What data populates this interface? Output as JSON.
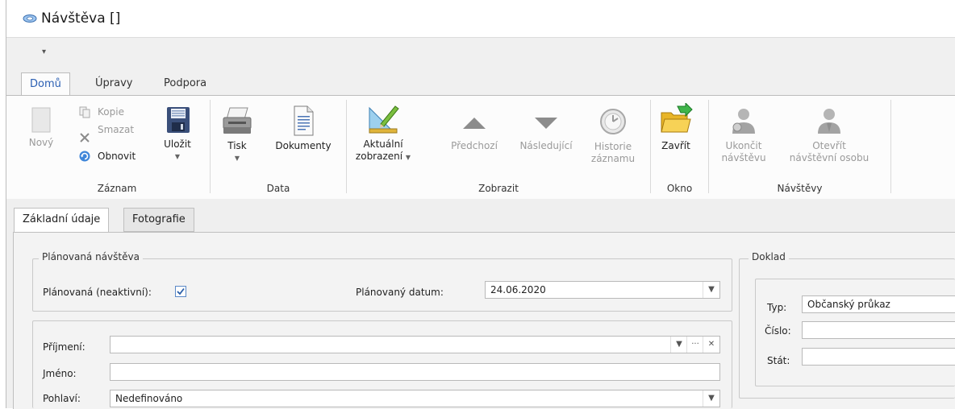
{
  "window": {
    "title": "Návštěva []"
  },
  "qat": {
    "customize_glyph": "▾"
  },
  "tabs": [
    {
      "label": "Domů",
      "active": true
    },
    {
      "label": "Úpravy",
      "active": false
    },
    {
      "label": "Podpora",
      "active": false
    }
  ],
  "ribbon": {
    "zaznam": {
      "label": "Záznam",
      "novy": "Nový",
      "kopie": "Kopie",
      "smazat": "Smazat",
      "obnovit": "Obnovit",
      "ulozit": "Uložit"
    },
    "data": {
      "label": "Data",
      "tisk": "Tisk",
      "dokumenty": "Dokumenty"
    },
    "zobrazit": {
      "label": "Zobrazit",
      "aktualni_1": "Aktuální",
      "aktualni_2": "zobrazení",
      "predchozi": "Předchozí",
      "nasledujici": "Následující",
      "historie_1": "Historie",
      "historie_2": "záznamu"
    },
    "okno": {
      "label": "Okno",
      "zavrit": "Zavřít"
    },
    "navstevy": {
      "label": "Návštěvy",
      "ukoncit_1": "Ukončit",
      "ukoncit_2": "návštěvu",
      "otevrit_1": "Otevřít",
      "otevrit_2": "návštěvní osobu"
    }
  },
  "content_tabs": [
    {
      "label": "Základní údaje",
      "active": true
    },
    {
      "label": "Fotografie",
      "active": false
    }
  ],
  "planovana": {
    "legend": "Plánovaná návštěva",
    "neaktivni_label": "Plánovaná (neaktivní):",
    "neaktivni_checked": true,
    "datum_label": "Plánovaný datum:",
    "datum_value": "24.06.2020"
  },
  "osoba": {
    "prijmeni_label": "Příjmení:",
    "prijmeni_value": "",
    "jmeno_label": "Jméno:",
    "jmeno_value": "",
    "pohlavi_label": "Pohlaví:",
    "pohlavi_value": "Nedefinováno",
    "ellipsis": "···",
    "clear": "✕"
  },
  "doklad": {
    "legend": "Doklad",
    "typ_label": "Typ:",
    "typ_value": "Občanský průkaz",
    "cislo_label": "Číslo:",
    "cislo_value": "",
    "stat_label": "Stát:",
    "stat_value": ""
  }
}
